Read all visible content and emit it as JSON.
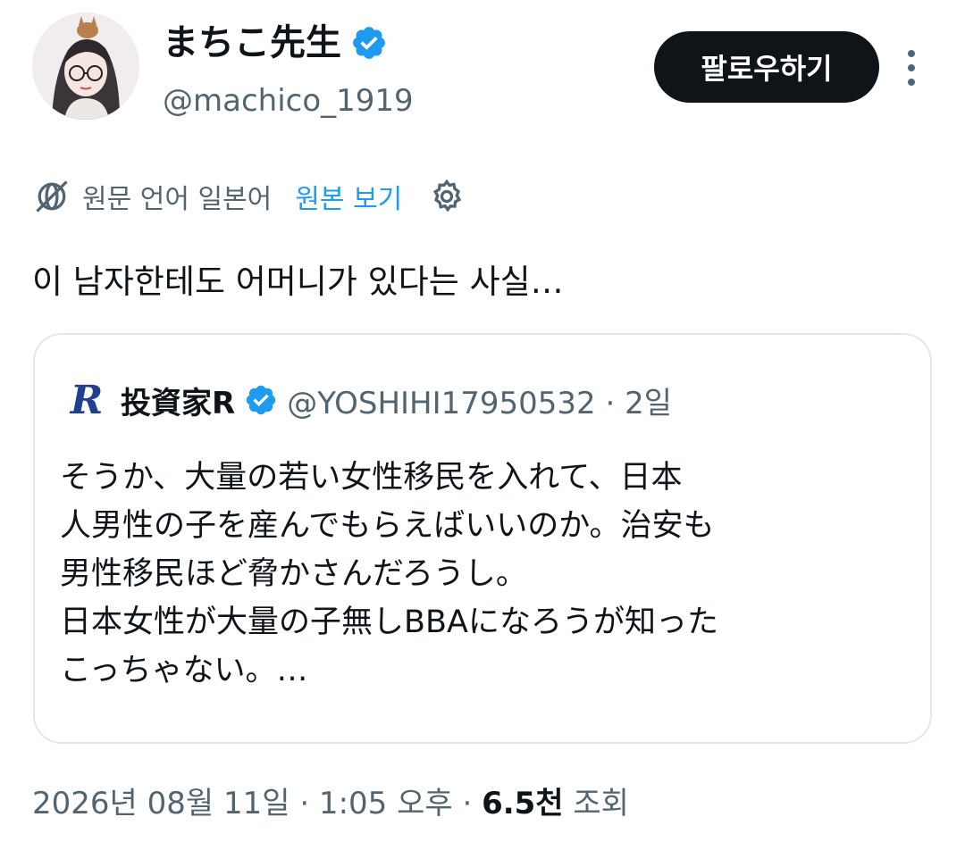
{
  "author": {
    "display_name": "まちこ先生",
    "handle": "@machico_1919"
  },
  "actions": {
    "follow_label": "팔로우하기"
  },
  "translation": {
    "source_language": "원문 언어 일본어",
    "show_original": "원본 보기"
  },
  "tweet": {
    "text": "이 남자한테도 어머니가 있다는 사실…"
  },
  "quote": {
    "author_name": "投資家R",
    "meta": "@YOSHIHI17950532 · 2일",
    "lines": [
      "そうか、大量の若い女性移民を入れて、日本",
      "人男性の子を産んでもらえばいいのか。治安も",
      "男性移民ほど脅かさんだろうし。",
      "日本女性が大量の子無しBBAになろうが知った",
      "こっちゃない。…"
    ]
  },
  "footer": {
    "date_time": "2026년 08월 11일 · 1:05 오후 · ",
    "views_count": "6.5천",
    "views_label": " 조회"
  },
  "colors": {
    "verified": "#1d9bf0",
    "link": "#1d9bf0",
    "secondary_text": "#536471",
    "button_bg": "#0f1419"
  },
  "icons": {
    "verified": "verified-badge-icon",
    "more": "more-options-icon",
    "translate": "translate-globe-icon",
    "settings": "gear-icon"
  }
}
